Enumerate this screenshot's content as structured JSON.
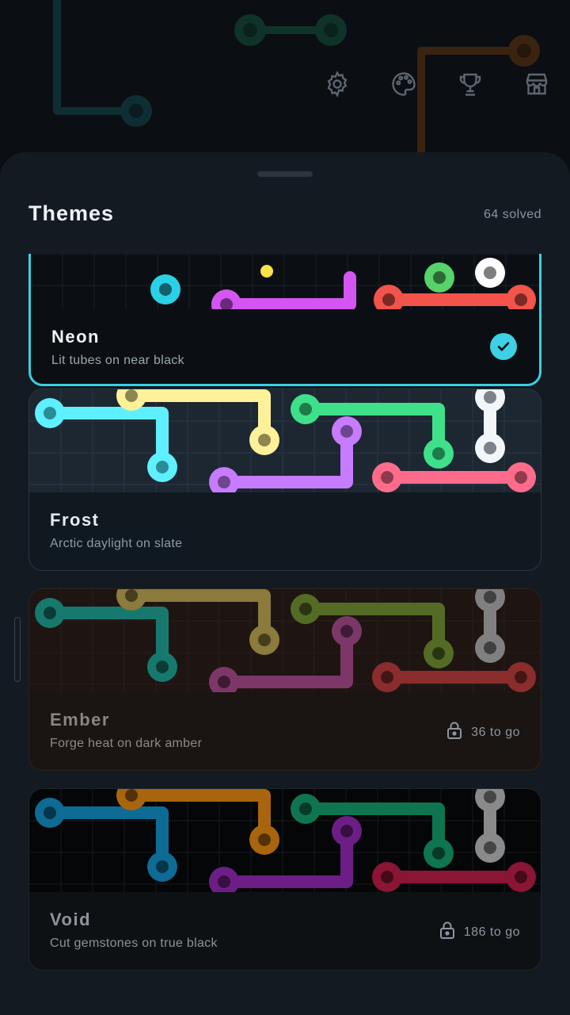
{
  "header": {
    "icons": [
      "gear-icon",
      "palette-icon",
      "trophy-icon",
      "store-icon"
    ]
  },
  "sheet": {
    "title": "Themes",
    "solved": "64 solved"
  },
  "themes": [
    {
      "name": "Neon",
      "description": "Lit tubes on near black",
      "status": "selected",
      "icon": "check-icon"
    },
    {
      "name": "Frost",
      "description": "Arctic daylight on slate",
      "status": "unlocked"
    },
    {
      "name": "Ember",
      "description": "Forge heat on dark amber",
      "status": "locked",
      "lock_text": "36 to go",
      "icon": "lock-icon"
    },
    {
      "name": "Void",
      "description": "Cut gemstones on true black",
      "status": "locked",
      "lock_text": "186 to go",
      "icon": "lock-icon"
    }
  ],
  "colors": {
    "accent": "#3dd0e6",
    "sheet_bg": "#141a21",
    "page_bg": "#0b0e12",
    "frost_palette": [
      "#5ef0ff",
      "#fff19a",
      "#3ee089",
      "#c77bff",
      "#f1f6fb",
      "#ff6b8b"
    ],
    "ember_palette": [
      "#17796e",
      "#8b7b3c",
      "#536b24",
      "#7c3768",
      "#808080",
      "#8b2d2d"
    ],
    "void_palette": [
      "#0e6b93",
      "#a8650d",
      "#0e7550",
      "#6d1e86",
      "#8a8a8a",
      "#8a1535"
    ],
    "neon_palette": [
      "#2ad1e6",
      "#ffe14a",
      "#56d36a",
      "#d456f2",
      "#ffffff",
      "#f2534a"
    ]
  }
}
